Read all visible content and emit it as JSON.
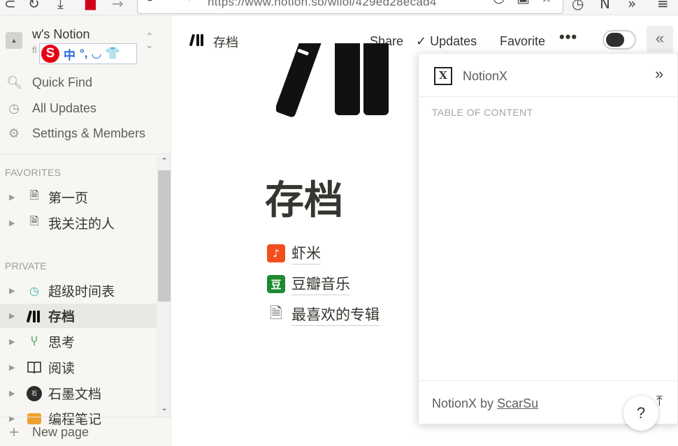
{
  "browser": {
    "url": "https://www.notion.so/wiloi/429ed28ecad4",
    "icons": [
      "reload-icon",
      "notion-extension-icon",
      "more-tools-icon",
      "menu-icon"
    ]
  },
  "workspace": {
    "icon_text": "▲",
    "name": "w's Notion",
    "sub": "fl"
  },
  "ime_toolbar": {
    "logo": "S",
    "items": [
      "中",
      "°,",
      "◡",
      "👕"
    ]
  },
  "sidebar": {
    "nav": [
      {
        "label": "Quick Find",
        "icon": "search-icon"
      },
      {
        "label": "All Updates",
        "icon": "clock-icon"
      },
      {
        "label": "Settings & Members",
        "icon": "gear-icon"
      }
    ],
    "favorites_label": "FAVORITES",
    "favorites": [
      {
        "label": "第一页",
        "icon": "document-icon"
      },
      {
        "label": "我关注的人",
        "icon": "document-icon"
      }
    ],
    "private_label": "PRIVATE",
    "private": [
      {
        "label": "超级时间表",
        "icon": "clock-icon"
      },
      {
        "label": "存档",
        "icon": "books-icon",
        "active": true
      },
      {
        "label": "思考",
        "icon": "sprout-icon"
      },
      {
        "label": "阅读",
        "icon": "open-book-icon"
      },
      {
        "label": "石墨文档",
        "icon": "shimo-icon"
      },
      {
        "label": "编程笔记",
        "icon": "notebook-icon"
      }
    ],
    "new_page": "New page"
  },
  "topbar": {
    "title": "存档",
    "share": "Share",
    "updates": "Updates",
    "favorite": "Favorite",
    "more": "•••"
  },
  "page": {
    "title": "存档",
    "links": [
      {
        "label": "虾米",
        "icon": "xiami-icon",
        "color": "#f24f1f"
      },
      {
        "label": "豆瓣音乐",
        "icon": "douban-icon",
        "color": "#1f8a32"
      },
      {
        "label": "最喜欢的专辑",
        "icon": "document-icon",
        "color": "#ffffff"
      }
    ]
  },
  "notionx": {
    "name": "NotionX",
    "logo": "X",
    "toc_label": "TABLE OF CONTENT",
    "footer_prefix": "NotionX by ",
    "footer_link": "ScarSu"
  },
  "help": "?"
}
